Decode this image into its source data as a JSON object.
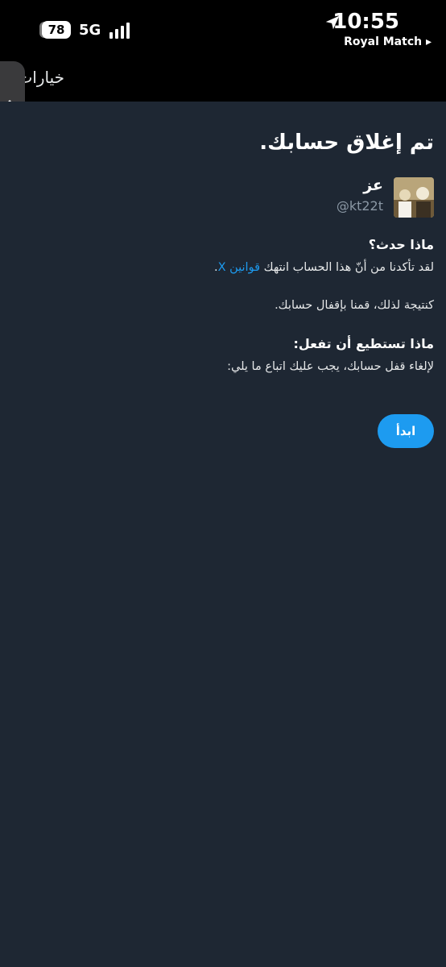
{
  "status_bar": {
    "battery": "78",
    "network": "5G",
    "time": "10:55",
    "back_app": "Royal Match ▸"
  },
  "top_bar": {
    "title": "خيارات"
  },
  "page": {
    "title": "تم إغلاق حسابك.",
    "user": {
      "name": "عز",
      "handle": "@kt22t"
    },
    "section1": {
      "heading": "ماذا حدث؟",
      "line1_prefix": "لقد تأكدنا من أنّ هذا الحساب انتهك ",
      "line1_link": "قوانين X",
      "line1_suffix": ".",
      "line2": "كنتيجة لذلك، قمنا بإقفال حسابك."
    },
    "section2": {
      "heading": "ماذا تستطيع أن تفعل:",
      "line1": "لإلغاء قفل حسابك، يجب عليك اتباع ما يلي:"
    },
    "start_button": "ابدأ"
  },
  "colors": {
    "background": "#1e2733",
    "accent": "#1d9bf0",
    "secondary_text": "#8b98a5"
  }
}
